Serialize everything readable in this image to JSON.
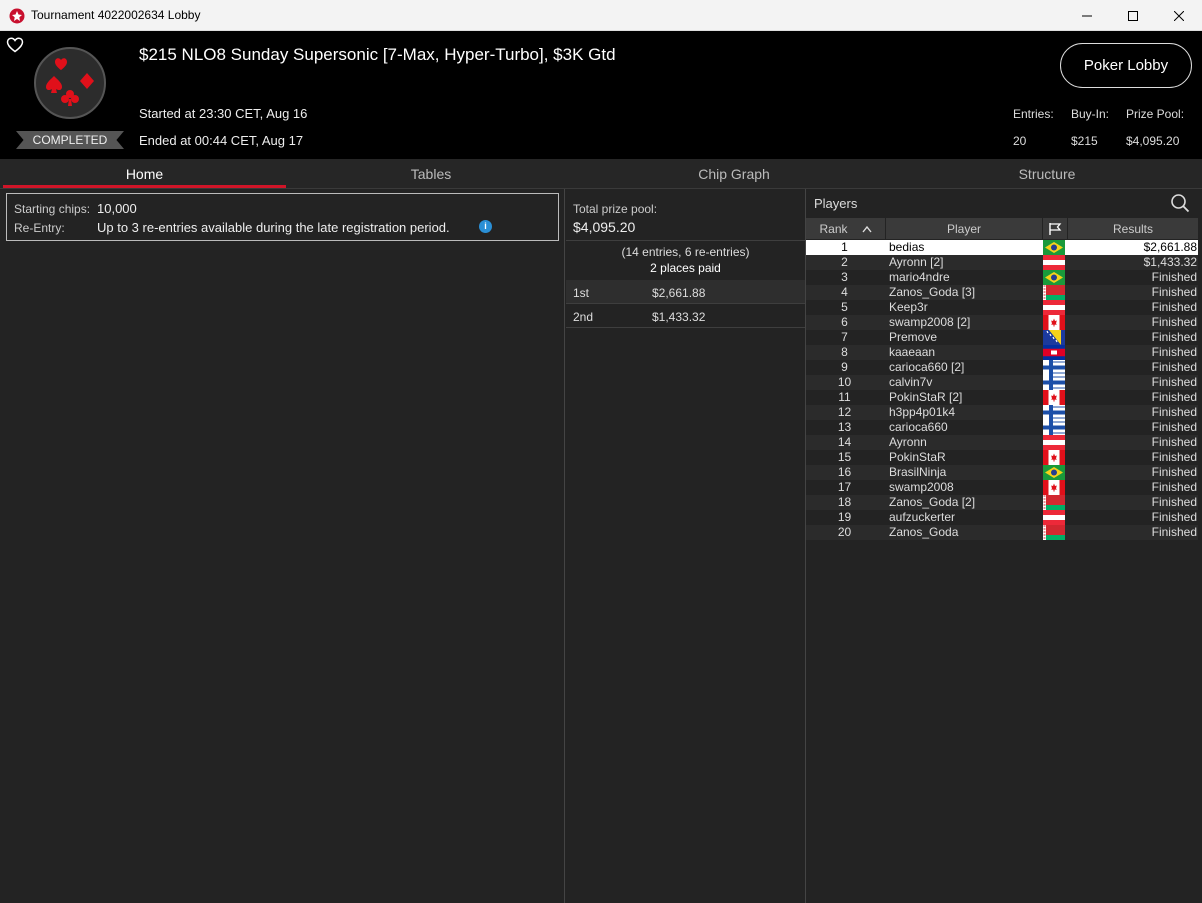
{
  "window": {
    "title": "Tournament 4022002634 Lobby"
  },
  "header": {
    "name": "$215 NLO8 Sunday Supersonic [7-Max, Hyper-Turbo], $3K Gtd",
    "status": "COMPLETED",
    "started": "Started at 23:30 CET, Aug 16",
    "ended": "Ended at 00:44 CET, Aug 17",
    "lobby_button": "Poker Lobby",
    "entries_label": "Entries:",
    "entries_value": "20",
    "buyin_label": "Buy-In:",
    "buyin_value": "$215",
    "prizepool_label": "Prize Pool:",
    "prizepool_value": "$4,095.20"
  },
  "tabs": [
    "Home",
    "Tables",
    "Chip Graph",
    "Structure"
  ],
  "info": {
    "chips_label": "Starting chips:",
    "chips_value": "10,000",
    "reentry_label": "Re-Entry:",
    "reentry_value": "Up to 3 re-entries available during the late registration period."
  },
  "prize_pool": {
    "label": "Total prize pool:",
    "value": "$4,095.20",
    "entries": "(14 entries, 6 re-entries)",
    "paid": "2 places paid",
    "payouts": [
      {
        "place": "1st",
        "amount": "$2,661.88"
      },
      {
        "place": "2nd",
        "amount": "$1,433.32"
      }
    ]
  },
  "players": {
    "title": "Players",
    "columns": {
      "rank": "Rank",
      "player": "Player",
      "results": "Results"
    },
    "rows": [
      {
        "rank": "1",
        "name": "bedias",
        "flag": "br",
        "result": "$2,661.88"
      },
      {
        "rank": "2",
        "name": "Ayronn [2]",
        "flag": "at",
        "result": "$1,433.32"
      },
      {
        "rank": "3",
        "name": "mario4ndre",
        "flag": "br",
        "result": "Finished"
      },
      {
        "rank": "4",
        "name": "Zanos_Goda [3]",
        "flag": "by",
        "result": "Finished"
      },
      {
        "rank": "5",
        "name": "Keep3r",
        "flag": "at",
        "result": "Finished"
      },
      {
        "rank": "6",
        "name": "swamp2008 [2]",
        "flag": "ca",
        "result": "Finished"
      },
      {
        "rank": "7",
        "name": "Premove",
        "flag": "ba",
        "result": "Finished"
      },
      {
        "rank": "8",
        "name": "kaaeaan",
        "flag": "kh",
        "result": "Finished"
      },
      {
        "rank": "9",
        "name": "carioca660 [2]",
        "flag": "fi",
        "result": "Finished"
      },
      {
        "rank": "10",
        "name": "calvin7v",
        "flag": "fi",
        "result": "Finished"
      },
      {
        "rank": "11",
        "name": "PokinStaR [2]",
        "flag": "ca",
        "result": "Finished"
      },
      {
        "rank": "12",
        "name": "h3pp4p01k4",
        "flag": "fi",
        "result": "Finished"
      },
      {
        "rank": "13",
        "name": "carioca660",
        "flag": "fi",
        "result": "Finished"
      },
      {
        "rank": "14",
        "name": "Ayronn",
        "flag": "at",
        "result": "Finished"
      },
      {
        "rank": "15",
        "name": "PokinStaR",
        "flag": "ca",
        "result": "Finished"
      },
      {
        "rank": "16",
        "name": "BrasilNinja",
        "flag": "br",
        "result": "Finished"
      },
      {
        "rank": "17",
        "name": "swamp2008",
        "flag": "ca",
        "result": "Finished"
      },
      {
        "rank": "18",
        "name": "Zanos_Goda [2]",
        "flag": "by",
        "result": "Finished"
      },
      {
        "rank": "19",
        "name": "aufzuckerter",
        "flag": "at",
        "result": "Finished"
      },
      {
        "rank": "20",
        "name": "Zanos_Goda",
        "flag": "by",
        "result": "Finished"
      }
    ]
  },
  "colors": {
    "accent": "#d01528",
    "header_bg": "#000000",
    "panel_bg": "#232323"
  }
}
